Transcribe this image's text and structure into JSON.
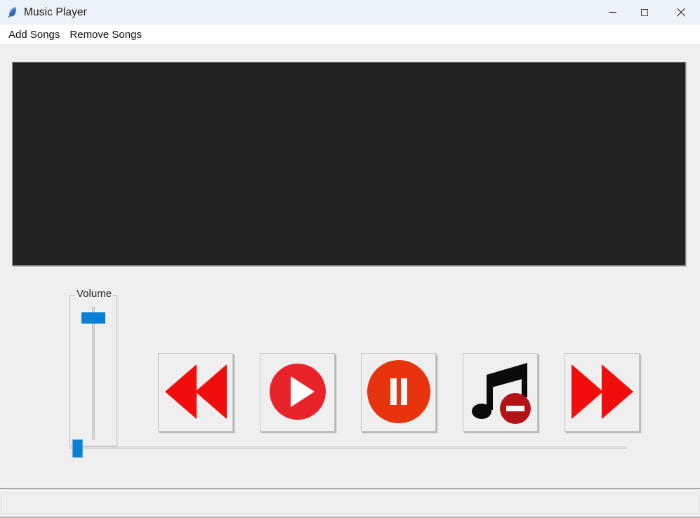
{
  "window": {
    "title": "Music Player",
    "icon": "feather-icon",
    "minimize_label": "Minimize",
    "maximize_label": "Maximize",
    "close_label": "Close"
  },
  "menubar": {
    "items": [
      {
        "label": "Add Songs"
      },
      {
        "label": "Remove Songs"
      }
    ]
  },
  "display": {
    "background_color": "#222222",
    "content": ""
  },
  "volume": {
    "legend": "Volume",
    "orientation": "vertical",
    "value_position_percent": 92,
    "thumb_color": "#0a7fd4",
    "track_color": "#d4d4d4"
  },
  "transport": {
    "buttons": [
      {
        "name": "previous-button",
        "icon": "rewind-icon",
        "label": "Previous",
        "color": "#f20d0d"
      },
      {
        "name": "play-button",
        "icon": "play-circle-icon",
        "label": "Play",
        "color": "#e8232a"
      },
      {
        "name": "pause-button",
        "icon": "pause-circle-icon",
        "label": "Pause",
        "color": "#e8340c"
      },
      {
        "name": "remove-song-button",
        "icon": "music-note-minus-icon",
        "label": "Remove Song",
        "color": "#b31217"
      },
      {
        "name": "next-button",
        "icon": "fast-forward-icon",
        "label": "Next",
        "color": "#f20d0d"
      }
    ]
  },
  "seek": {
    "value_percent": 0,
    "thumb_color": "#0a7fd4",
    "track_color": "#dedede"
  },
  "statusbar": {
    "text": ""
  },
  "colors": {
    "titlebar_bg": "#ebf2f9",
    "menubar_bg": "#ffffff",
    "body_bg": "#efefef",
    "accent_blue": "#0a7fd4",
    "accent_red": "#f20d0d"
  }
}
